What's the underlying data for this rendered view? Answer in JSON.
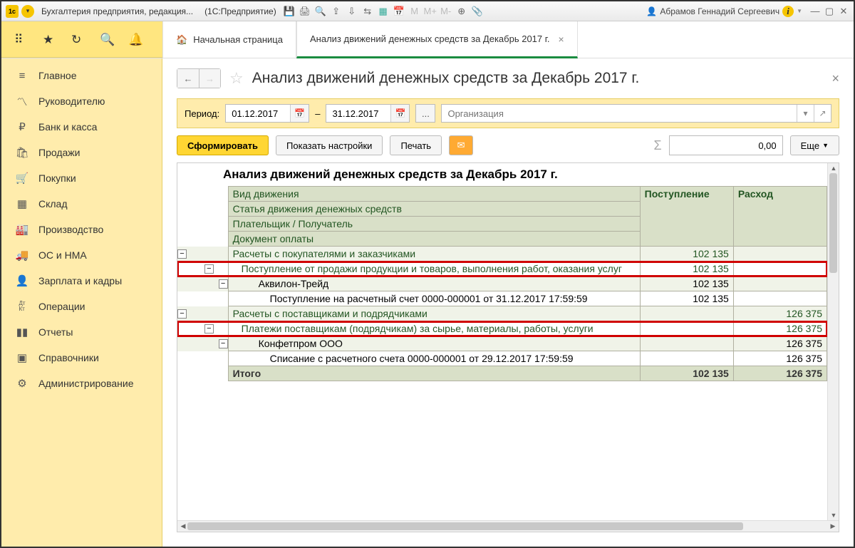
{
  "titlebar": {
    "app_name": "Бухгалтерия предприятия, редакция...",
    "platform": "(1С:Предприятие)",
    "user": "Абрамов Геннадий Сергеевич",
    "m_btns": [
      "M",
      "M+",
      "M-"
    ]
  },
  "tabs": {
    "home": "Начальная страница",
    "active": "Анализ движений денежных средств за Декабрь 2017 г."
  },
  "sidebar": [
    {
      "id": "main",
      "label": "Главное",
      "icon": "≡"
    },
    {
      "id": "manager",
      "label": "Руководителю",
      "icon": "📈"
    },
    {
      "id": "bank",
      "label": "Банк и касса",
      "icon": "₽"
    },
    {
      "id": "sales",
      "label": "Продажи",
      "icon": "🛍"
    },
    {
      "id": "purchases",
      "label": "Покупки",
      "icon": "🛒"
    },
    {
      "id": "warehouse",
      "label": "Склад",
      "icon": "▦"
    },
    {
      "id": "production",
      "label": "Производство",
      "icon": "🏭"
    },
    {
      "id": "os",
      "label": "ОС и НМА",
      "icon": "🚚"
    },
    {
      "id": "salary",
      "label": "Зарплата и кадры",
      "icon": "👤"
    },
    {
      "id": "operations",
      "label": "Операции",
      "icon": "Дт Кт"
    },
    {
      "id": "reports",
      "label": "Отчеты",
      "icon": "📊"
    },
    {
      "id": "refs",
      "label": "Справочники",
      "icon": "📚"
    },
    {
      "id": "admin",
      "label": "Администрирование",
      "icon": "⚙"
    }
  ],
  "page": {
    "title": "Анализ движений денежных средств за Декабрь 2017 г."
  },
  "period": {
    "label": "Период:",
    "from": "01.12.2017",
    "to": "31.12.2017",
    "sep": "–",
    "org_placeholder": "Организация"
  },
  "toolbar": {
    "generate": "Сформировать",
    "settings": "Показать настройки",
    "print": "Печать",
    "amount": "0,00",
    "more": "Еще"
  },
  "report": {
    "title": "Анализ движений денежных средств за Декабрь 2017 г.",
    "headers": {
      "movement_type": "Вид движения",
      "article": "Статья движения денежных средств",
      "payer": "Плательщик / Получатель",
      "doc": "Документ оплаты",
      "income": "Поступление",
      "expense": "Расход"
    },
    "rows": [
      {
        "lvl": 0,
        "desc": "Расчеты с покупателями и заказчиками",
        "in": "102 135",
        "out": ""
      },
      {
        "lvl": 1,
        "desc": "Поступление от продажи продукции и товаров, выполнения работ, оказания услуг",
        "in": "102 135",
        "out": "",
        "hl": true
      },
      {
        "lvl": 2,
        "desc": "Аквилон-Трейд",
        "in": "102 135",
        "out": ""
      },
      {
        "lvl": 3,
        "desc": "Поступление на расчетный счет 0000-000001 от 31.12.2017 17:59:59",
        "in": "102 135",
        "out": ""
      },
      {
        "lvl": 0,
        "desc": "Расчеты с поставщиками и подрядчиками",
        "in": "",
        "out": "126 375"
      },
      {
        "lvl": 1,
        "desc": "Платежи поставщикам (подрядчикам) за сырье, материалы, работы, услуги",
        "in": "",
        "out": "126 375",
        "hl": true
      },
      {
        "lvl": 2,
        "desc": "Конфетпром ООО",
        "in": "",
        "out": "126 375"
      },
      {
        "lvl": 3,
        "desc": "Списание с расчетного счета 0000-000001 от 29.12.2017 17:59:59",
        "in": "",
        "out": "126 375"
      }
    ],
    "total": {
      "label": "Итого",
      "in": "102 135",
      "out": "126 375"
    }
  }
}
